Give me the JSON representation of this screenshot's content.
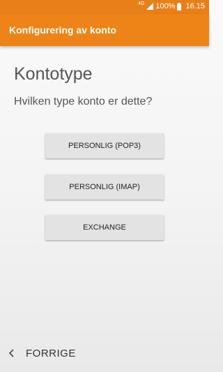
{
  "status_bar": {
    "network": "4G",
    "battery": "100%",
    "time": "16.15"
  },
  "app_bar": {
    "title": "Konfigurering av konto"
  },
  "content": {
    "heading": "Kontotype",
    "question": "Hvilken type konto er dette?",
    "options": [
      {
        "label": "PERSONLIG (POP3)"
      },
      {
        "label": "PERSONLIG (IMAP)"
      },
      {
        "label": "EXCHANGE"
      }
    ]
  },
  "bottom_nav": {
    "back_label": "FORRIGE",
    "back_icon": "chevron-left-icon"
  },
  "colors": {
    "accent": "#ee8417",
    "status_bar": "#e8801a"
  }
}
